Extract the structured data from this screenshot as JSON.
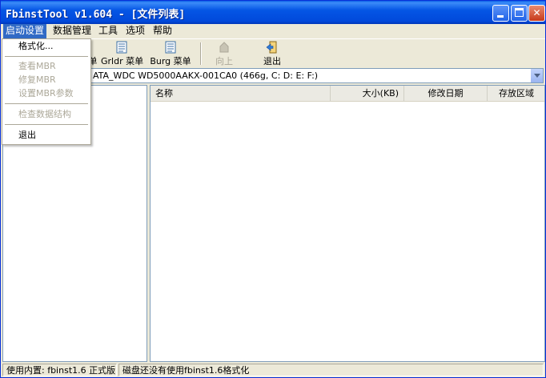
{
  "window": {
    "title": "FbinstTool v1.604 - [文件列表]"
  },
  "menubar": {
    "items": [
      "启动设置",
      "数据管理",
      "工具",
      "选项",
      "帮助"
    ]
  },
  "toolbar": {
    "partial_label": "单",
    "grldr": "Grldr 菜单",
    "burg": "Burg 菜单",
    "up": "向上",
    "exit": "退出"
  },
  "disk": {
    "selected": "ATA_WDC WD5000AAKX-001CA0 (466g, C: D: E: F:)"
  },
  "file_list": {
    "columns": [
      "名称",
      "大小(KB)",
      "修改日期",
      "存放区域"
    ],
    "rows": []
  },
  "dropdown": {
    "items": [
      {
        "label": "格式化...",
        "enabled": true
      },
      {
        "label": "查看MBR",
        "enabled": false
      },
      {
        "label": "修复MBR",
        "enabled": false
      },
      {
        "label": "设置MBR参数",
        "enabled": false
      },
      {
        "label": "检查数据结构",
        "enabled": false
      },
      {
        "label": "退出",
        "enabled": true
      }
    ]
  },
  "status": {
    "left": "使用内置: fbinst1.6 正式版",
    "right": "磁盘还没有使用fbinst1.6格式化"
  },
  "colors": {
    "titlebar": "#0149DB",
    "menu_highlight": "#316AC5",
    "window_bg": "#ECE9D8",
    "disabled_text": "#ACA899"
  },
  "icons": [
    "app-icon",
    "grldr-menu-icon",
    "burg-menu-icon",
    "up-arrow-icon",
    "exit-icon",
    "chevron-down-icon",
    "minimize-icon",
    "maximize-icon",
    "close-icon"
  ]
}
